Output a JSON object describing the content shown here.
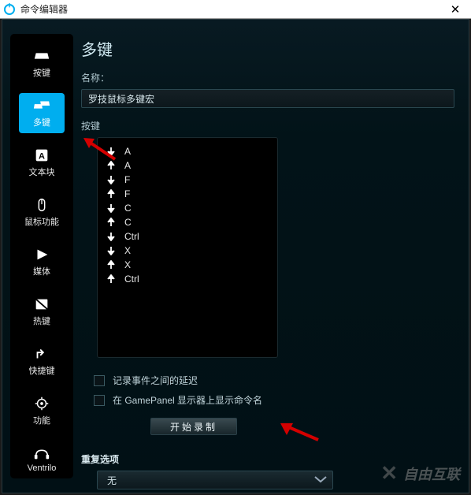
{
  "window": {
    "title": "命令编辑器"
  },
  "sidebar": {
    "items": [
      {
        "id": "keystroke",
        "label": "按键"
      },
      {
        "id": "multikey",
        "label": "多键"
      },
      {
        "id": "textblock",
        "label": "文本块"
      },
      {
        "id": "mousefn",
        "label": "鼠标功能"
      },
      {
        "id": "media",
        "label": "媒体"
      },
      {
        "id": "hotkeys",
        "label": "热键"
      },
      {
        "id": "shortcut",
        "label": "快捷键"
      },
      {
        "id": "function",
        "label": "功能"
      },
      {
        "id": "ventrilo",
        "label": "Ventrilo"
      }
    ],
    "active_index": 1
  },
  "main": {
    "heading": "多键",
    "name_label": "名称：",
    "name_value": "罗技鼠标多键宏",
    "keys_label": "按键",
    "key_events": [
      {
        "dir": "down",
        "key": "A"
      },
      {
        "dir": "up",
        "key": "A"
      },
      {
        "dir": "down",
        "key": "F"
      },
      {
        "dir": "up",
        "key": "F"
      },
      {
        "dir": "down",
        "key": "C"
      },
      {
        "dir": "up",
        "key": "C"
      },
      {
        "dir": "down",
        "key": "Ctrl"
      },
      {
        "dir": "down",
        "key": "X"
      },
      {
        "dir": "up",
        "key": "X"
      },
      {
        "dir": "up",
        "key": "Ctrl"
      }
    ],
    "record_delay_label": "记录事件之间的延迟",
    "record_delay_checked": false,
    "gamepanel_label": "在 GamePanel 显示器上显示命令名",
    "gamepanel_checked": false,
    "start_record_label": "开始录制",
    "repeat_heading": "重复选项",
    "repeat_selected": "无"
  },
  "watermark": {
    "text": "自由互联"
  }
}
